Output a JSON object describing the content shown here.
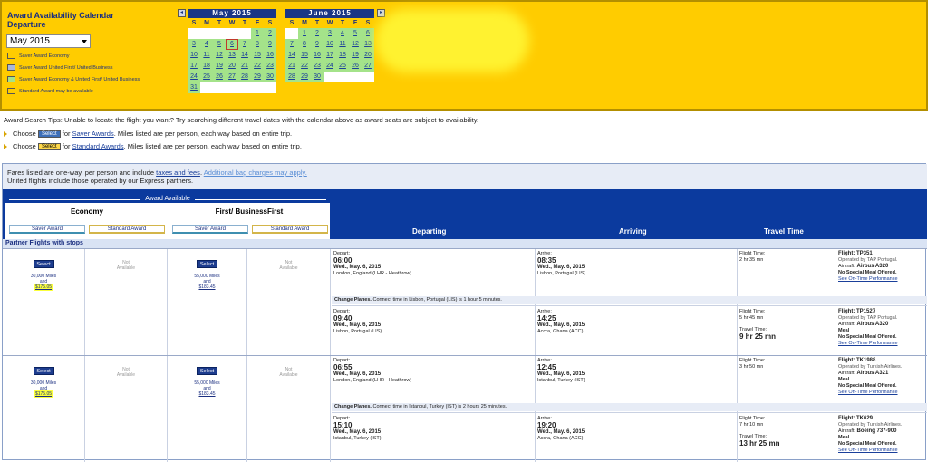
{
  "calendar": {
    "title_line1": "Award Availability Calendar",
    "title_line2": "Departure",
    "month_select": "May 2015",
    "legend": [
      {
        "label": "Saver Award Economy",
        "color": "#ffffff"
      },
      {
        "label": "Saver Award United First/ United Business",
        "color": "#a9b8d8"
      },
      {
        "label": "Saver Award Economy & United First/ United Business",
        "color": "#a4e38a"
      },
      {
        "label": "Standard Award may be available",
        "color": "#ffffff"
      }
    ],
    "days_of_week": [
      "S",
      "M",
      "T",
      "W",
      "T",
      "F",
      "S"
    ],
    "nav_prev": "◂",
    "nav_next": "▸",
    "months": [
      {
        "name": "May 2015",
        "offset": 5,
        "days": [
          "1",
          "2",
          "3",
          "4",
          "5",
          "6",
          "7",
          "8",
          "9",
          "10",
          "11",
          "12",
          "13",
          "14",
          "15",
          "16",
          "17",
          "18",
          "19",
          "20",
          "21",
          "22",
          "23",
          "24",
          "25",
          "26",
          "27",
          "28",
          "29",
          "30",
          "31"
        ],
        "highlighted_from": 1,
        "selected": "6"
      },
      {
        "name": "June 2015",
        "offset": 1,
        "days": [
          "1",
          "2",
          "3",
          "4",
          "5",
          "6",
          "7",
          "8",
          "9",
          "10",
          "11",
          "12",
          "13",
          "14",
          "15",
          "16",
          "17",
          "18",
          "19",
          "20",
          "21",
          "22",
          "23",
          "24",
          "25",
          "26",
          "27",
          "28",
          "29",
          "30"
        ],
        "highlighted_from": 1,
        "selected": ""
      }
    ]
  },
  "tips": {
    "intro": "Award Search Tips: Unable to locate the flight you want? Try searching different travel dates with the calendar above as award seats are subject to availability.",
    "line1_pre": "Choose",
    "line1_btn": "Select",
    "line1_mid": "for",
    "line1_link": "Saver Awards",
    "line1_post": ". Miles listed are per person, each way based on entire trip.",
    "line2_pre": "Choose",
    "line2_btn": "Select",
    "line2_mid": "for",
    "line2_link": "Standard Awards",
    "line2_post": ". Miles listed are per person, each way based on entire trip."
  },
  "notice": {
    "pre": "Fares listed are one-way, per person and include",
    "link1": "taxes and fees",
    "mid": ".",
    "link2": "Additional bag charges may apply.",
    "line2": "United flights include those operated by our Express partners."
  },
  "header": {
    "award_available": "Award Available",
    "economy": "Economy",
    "first_business": "First/ BusinessFirst",
    "saver_award": "Saver Award",
    "standard_award": "Standard Award",
    "departing": "Departing",
    "arriving": "Arriving",
    "travel_time": "Travel Time"
  },
  "partner_bar": "Partner Flights with stops",
  "itineraries": [
    {
      "econ_select": "Select",
      "econ_miles": "30,000 Miles",
      "econ_and": "and",
      "econ_price": "$175.05",
      "econ_std_na_1": "Not",
      "econ_std_na_2": "Available",
      "first_select": "Select",
      "first_miles": "55,000 Miles",
      "first_and": "and",
      "first_price": "$183.45",
      "first_std_na_1": "Not",
      "first_std_na_2": "Available",
      "segments": [
        {
          "depart_label": "Depart:",
          "depart_time": "06:00",
          "depart_date": "Wed., May. 6, 2015",
          "depart_place": "London, England (LHR - Heathrow)",
          "arrive_label": "Arrive:",
          "arrive_time": "08:35",
          "arrive_date": "Wed., May. 6, 2015",
          "arrive_place": "Lisbon, Portugal (LIS)",
          "ft_label": "Flight Time:",
          "ft_value": "2 hr 35 mn",
          "flight": "Flight: TP351",
          "operated": "Operated by TAP Portugal.",
          "aircraft_label": "Aircraft:",
          "aircraft": "Airbus A320",
          "meal_label": "Meal:",
          "meal": "No Special Meal Offered.",
          "ontime": "See On-Time Performance",
          "tt_label": "",
          "tt_value": ""
        },
        {
          "depart_label": "Depart:",
          "depart_time": "09:40",
          "depart_date": "Wed., May. 6, 2015",
          "depart_place": "Lisbon, Portugal (LIS)",
          "arrive_label": "Arrive:",
          "arrive_time": "14:25",
          "arrive_date": "Wed., May. 6, 2015",
          "arrive_place": "Accra, Ghana (ACC)",
          "ft_label": "Flight Time:",
          "ft_value": "5 hr 45 mn",
          "flight": "Flight: TP1527",
          "operated": "Operated by TAP Portugal.",
          "aircraft_label": "Aircraft:",
          "aircraft": "Airbus A320",
          "meal_label": "Meal:",
          "meal_line": "Meal",
          "meal": "No Special Meal Offered.",
          "ontime": "See On-Time Performance",
          "tt_label": "Travel Time:",
          "tt_value": "9 hr 25 mn"
        }
      ],
      "change_bold": "Change Planes.",
      "change_text": " Connect time in Lisbon, Portugal (LIS) is 1 hour 5 minutes."
    },
    {
      "econ_select": "Select",
      "econ_miles": "30,000 Miles",
      "econ_and": "and",
      "econ_price": "$175.05",
      "econ_std_na_1": "Not",
      "econ_std_na_2": "Available",
      "first_select": "Select",
      "first_miles": "55,000 Miles",
      "first_and": "and",
      "first_price": "$183.45",
      "first_std_na_1": "Not",
      "first_std_na_2": "Available",
      "segments": [
        {
          "depart_label": "Depart:",
          "depart_time": "06:55",
          "depart_date": "Wed., May. 6, 2015",
          "depart_place": "London, England (LHR - Heathrow)",
          "arrive_label": "Arrive:",
          "arrive_time": "12:45",
          "arrive_date": "Wed., May. 6, 2015",
          "arrive_place": "Istanbul, Turkey (IST)",
          "ft_label": "Flight Time:",
          "ft_value": "3 hr 50 mn",
          "flight": "Flight: TK1988",
          "operated": "Operated by Turkish Airlines.",
          "aircraft_label": "Aircraft:",
          "aircraft": "Airbus A321",
          "meal_label": "Meal:",
          "meal_line": "Meal",
          "meal": "No Special Meal Offered.",
          "ontime": "See On-Time Performance",
          "tt_label": "",
          "tt_value": ""
        },
        {
          "depart_label": "Depart:",
          "depart_time": "15:10",
          "depart_date": "Wed., May. 6, 2015",
          "depart_place": "Istanbul, Turkey (IST)",
          "arrive_label": "Arrive:",
          "arrive_time": "19:20",
          "arrive_date": "Wed., May. 6, 2015",
          "arrive_place": "Accra, Ghana (ACC)",
          "ft_label": "Flight Time:",
          "ft_value": "7 hr 10 mn",
          "flight": "Flight: TK629",
          "operated": "Operated by Turkish Airlines.",
          "aircraft_label": "Aircraft:",
          "aircraft": "Boeing 737-900",
          "meal_label": "Meal:",
          "meal_line": "Meal",
          "meal": "No Special Meal Offered.",
          "ontime": "See On-Time Performance",
          "tt_label": "Travel Time:",
          "tt_value": "13 hr 25 mn"
        }
      ],
      "change_bold": "Change Planes.",
      "change_text": " Connect time in Istanbul, Turkey (IST) is 2 hours 25 minutes."
    }
  ]
}
